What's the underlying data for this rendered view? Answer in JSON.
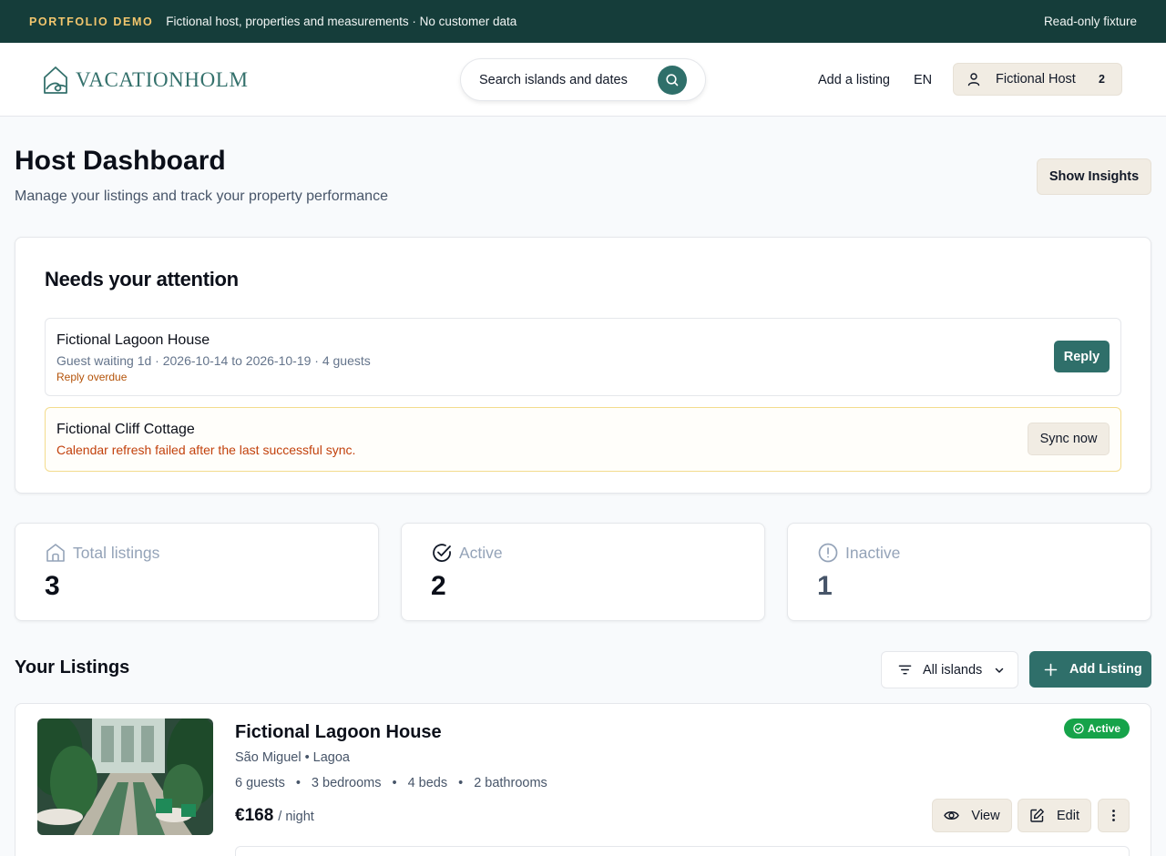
{
  "banner": {
    "tag": "PORTFOLIO DEMO",
    "text": "Fictional host, properties and measurements · No customer data",
    "right": "Read-only fixture"
  },
  "header": {
    "logo_text": "VACATIONHOLM",
    "search_placeholder": "Search islands and dates",
    "add_listing": "Add a listing",
    "language": "EN",
    "host_name": "Fictional Host",
    "host_count": "2"
  },
  "page": {
    "title": "Host Dashboard",
    "subtitle": "Manage your listings and track your property performance",
    "insights_button": "Show Insights"
  },
  "attention": {
    "title": "Needs your attention",
    "items": [
      {
        "name": "Fictional Lagoon House",
        "detail": "Guest waiting 1d · 2026-10-14 to 2026-10-19 · 4 guests",
        "note": "Reply overdue",
        "action": "Reply"
      },
      {
        "name": "Fictional Cliff Cottage",
        "detail": "Calendar refresh failed after the last successful sync.",
        "action": "Sync now"
      }
    ]
  },
  "stats": [
    {
      "label": "Total listings",
      "value": "3",
      "icon": "home-icon"
    },
    {
      "label": "Active",
      "value": "2",
      "icon": "check-circle-icon"
    },
    {
      "label": "Inactive",
      "value": "1",
      "icon": "alert-circle-icon"
    }
  ],
  "listings": {
    "title": "Your Listings",
    "filter": "All islands",
    "add_button": "Add Listing",
    "items": [
      {
        "name": "Fictional Lagoon House",
        "location": "São Miguel • Lagoa",
        "guests": "6 guests",
        "bedrooms": "3 bedrooms",
        "beds": "4 beds",
        "bathrooms": "2 bathrooms",
        "price": "€168",
        "price_unit": "/ night",
        "status": "Active",
        "view": "View",
        "edit": "Edit"
      }
    ]
  },
  "colors": {
    "banner_bg": "#153d3a",
    "banner_tag": "#f2c66d",
    "brand": "#2f6f6a",
    "status_active": "#16a34a",
    "warning_text": "#c2410c"
  }
}
